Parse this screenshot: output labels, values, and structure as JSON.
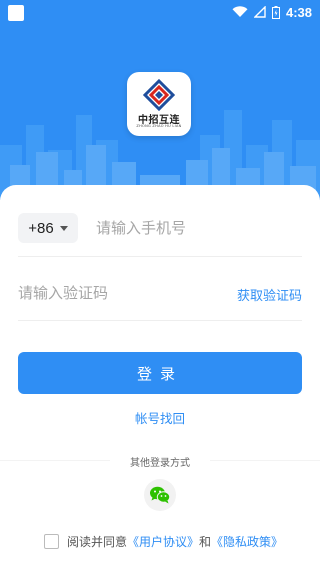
{
  "status_bar": {
    "time": "4:38",
    "icons": [
      "app-square-icon",
      "wifi-icon",
      "signal-icon",
      "battery-icon"
    ]
  },
  "logo": {
    "name": "中招互连",
    "subtitle": "ZHONG ZHAO HU LIAN"
  },
  "login_form": {
    "country_code": "+86",
    "phone_placeholder": "请输入手机号",
    "code_placeholder": "请输入验证码",
    "get_code_label": "获取验证码",
    "login_label": "登录",
    "forgot_account_label": "帐号找回"
  },
  "other_login": {
    "label": "其他登录方式",
    "methods": [
      "wechat-icon"
    ]
  },
  "agreement": {
    "prefix": "阅读并同意",
    "user_agreement": "《用户协议》",
    "conjunction": "和",
    "privacy_policy": "《隐私政策》",
    "checked": false
  },
  "colors": {
    "primary": "#2f8ef4",
    "wechat": "#2dc100"
  }
}
